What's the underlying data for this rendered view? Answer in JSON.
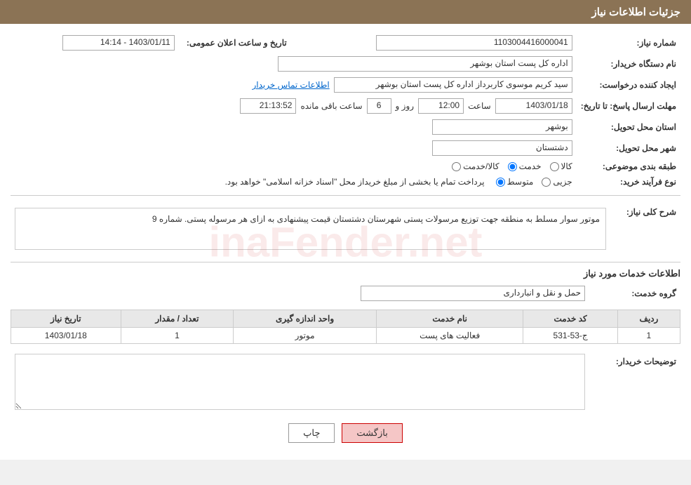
{
  "header": {
    "title": "جزئیات اطلاعات نیاز"
  },
  "fields": {
    "need_number_label": "شماره نیاز:",
    "need_number_value": "1103004416000041",
    "buyer_org_label": "نام دستگاه خریدار:",
    "buyer_org_value": "اداره کل پست استان بوشهر",
    "creator_label": "ایجاد کننده درخواست:",
    "creator_value": "سید کریم موسوی کاربرداز اداره کل پست استان بوشهر",
    "creator_link": "اطلاعات تماس خریدار",
    "deadline_label": "مهلت ارسال پاسخ: تا تاریخ:",
    "deadline_date": "1403/01/18",
    "deadline_time_label": "ساعت",
    "deadline_time": "12:00",
    "deadline_days_label": "روز و",
    "deadline_days": "6",
    "deadline_remaining_label": "ساعت باقی مانده",
    "deadline_remaining": "21:13:52",
    "announce_label": "تاریخ و ساعت اعلان عمومی:",
    "announce_value": "1403/01/11 - 14:14",
    "province_label": "استان محل تحویل:",
    "province_value": "بوشهر",
    "city_label": "شهر محل تحویل:",
    "city_value": "دشتستان",
    "category_label": "طبقه بندی موضوعی:",
    "category_options": [
      "کالا",
      "خدمت",
      "کالا/خدمت"
    ],
    "category_selected": "خدمت",
    "process_label": "نوع فرآیند خرید:",
    "process_options": [
      "جزیی",
      "متوسط"
    ],
    "process_selected": "متوسط",
    "process_notice": "پرداخت تمام یا بخشی از مبلغ خریداز محل \"اسناد خزانه اسلامی\" خواهد بود."
  },
  "description_section": {
    "title": "شرح کلی نیاز:",
    "text": "موتور سوار مسلط به منطقه جهت توزیع مرسولات پستی شهرستان دشتستان قیمت پیشنهادی به ازای هر مرسوله پستی. شماره 9"
  },
  "services_section": {
    "title": "اطلاعات خدمات مورد نیاز",
    "service_group_label": "گروه خدمت:",
    "service_group_value": "حمل و نقل و انبارداری",
    "table_headers": [
      "ردیف",
      "کد خدمت",
      "نام خدمت",
      "واحد اندازه گیری",
      "تعداد / مقدار",
      "تاریخ نیاز"
    ],
    "table_rows": [
      {
        "row": "1",
        "code": "ج-53-531",
        "name": "فعالیت های پست",
        "unit": "موتور",
        "quantity": "1",
        "date": "1403/01/18"
      }
    ]
  },
  "buyer_desc_label": "توضیحات خریدار:",
  "buyer_desc_value": "",
  "buttons": {
    "print": "چاپ",
    "back": "بازگشت"
  }
}
